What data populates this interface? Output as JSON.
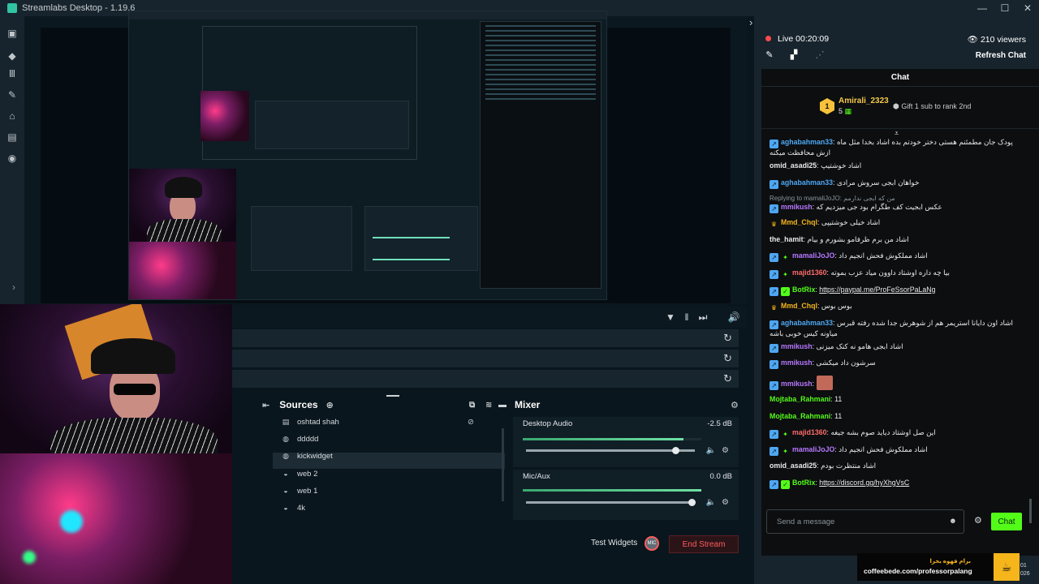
{
  "window": {
    "title": "Streamlabs Desktop - 1.19.6",
    "controls": [
      "—",
      "☐",
      "✕"
    ]
  },
  "scenes": {
    "toolbar_icons": [
      "filter-icon",
      "pause-icon",
      "skip-icon",
      "volume-icon"
    ]
  },
  "sources": {
    "title": "Sources",
    "items": [
      {
        "label": "oshtad shah",
        "icon": "file-icon"
      },
      {
        "label": "ddddd",
        "icon": "globe-icon"
      },
      {
        "label": "kickwidget",
        "icon": "globe-icon"
      },
      {
        "label": "web 2",
        "icon": "webcam-icon"
      },
      {
        "label": "web 1",
        "icon": "webcam-icon"
      },
      {
        "label": "4k",
        "icon": "webcam-icon"
      }
    ]
  },
  "mixer": {
    "title": "Mixer",
    "tracks": [
      {
        "name": "Desktop Audio",
        "db": "-2.5 dB",
        "level": 0.9
      },
      {
        "name": "Mic/Aux",
        "db": "0.0 dB",
        "level": 1.0
      }
    ]
  },
  "footer": {
    "test_widgets": "Test Widgets",
    "mic_label": "MIC",
    "end_stream": "End Stream"
  },
  "live": {
    "status": "Live 00:20:09",
    "viewers": "210 viewers",
    "refresh": "Refresh Chat",
    "color": "#ff4a4a"
  },
  "chat": {
    "title": "Chat",
    "pinned": {
      "rank": "1",
      "user": "Amirali_2323",
      "count": "5",
      "gift": "Gift 1 sub to rank 2nd"
    },
    "messages": [
      {
        "user": "aghabahman33",
        "color": "#4ea7f2",
        "badge": "kick",
        "text": "پودک جان مطمئنم هستی دختر خودتم بده اشاد بخدا مثل ماه ازش محافظت میکنه"
      },
      {
        "user": "omid_asadi25",
        "color": "#e8ebed",
        "badge": "",
        "text": "اشاد خوشتیپ"
      },
      {
        "user": "aghabahman33",
        "color": "#4ea7f2",
        "badge": "kick",
        "text": "خواهان ابجی سروش مرادی"
      },
      {
        "reply": "Replying to mamaliJoJO: من که ابجی ندارمم",
        "user": "mmikush",
        "color": "#b878ff",
        "badge": "kick",
        "text": "عکس ابجیت کف طگرام بود جی میزدیم که"
      },
      {
        "user": "Mmd_Chql",
        "color": "#f5b51b",
        "badge": "crown",
        "text": "اشاد خیلی خوشتیپی"
      },
      {
        "user": "the_hamit",
        "color": "#e8ebed",
        "badge": "",
        "text": "اشاد من برم ظرفامو بشورم و بیام"
      },
      {
        "user": "mamaliJoJO",
        "color": "#b878ff",
        "badge": "kick-star",
        "text": "اشاد مملکوش فحش انجیم داد"
      },
      {
        "user": "majid1360",
        "color": "#ff6b6b",
        "badge": "kick-star",
        "text": "بیا چه داره اوشتاد داوون میاد عزب بموته"
      },
      {
        "user": "BotRix",
        "color": "#53fc18",
        "badge": "kick-verified",
        "text": "https://paypal.me/ProFeSsorPaLaNg",
        "link": true
      },
      {
        "user": "Mmd_Chql",
        "color": "#f5b51b",
        "badge": "crown",
        "text": "بوس بوس"
      },
      {
        "user": "aghabahman33",
        "color": "#4ea7f2",
        "badge": "kick",
        "text": "اشاد اون دایانا استریمر هم از شوهرش جدا شده رفته قبرس میاونه کیس خوبی باشه"
      },
      {
        "user": "mmikush",
        "color": "#b878ff",
        "badge": "kick",
        "text": "اشاد ابجی هامو نه کنک میزنی"
      },
      {
        "user": "mmikush",
        "color": "#b878ff",
        "badge": "kick",
        "text": "سرشون داد میکشی"
      },
      {
        "user": "mmikush",
        "color": "#b878ff",
        "badge": "kick",
        "text": "",
        "emote": true
      },
      {
        "user": "Mojtaba_Rahmani",
        "color": "#53fc18",
        "badge": "",
        "text": "11"
      },
      {
        "user": "Mojtaba_Rahmani",
        "color": "#53fc18",
        "badge": "",
        "text": "11"
      },
      {
        "user": "majid1360",
        "color": "#ff6b6b",
        "badge": "kick-star",
        "text": "این صل اوشتاد دیاید صوم بشه جیغه"
      },
      {
        "user": "mamaliJoJO",
        "color": "#b878ff",
        "badge": "kick-star",
        "text": "اشاد مملکوش فحش انجیم داد"
      },
      {
        "user": "omid_asadi25",
        "color": "#e8ebed",
        "badge": "",
        "text": "اشاد منتظرت بودم"
      },
      {
        "user": "BotRix",
        "color": "#53fc18",
        "badge": "kick-verified",
        "text": "https://discord.gg/hyXhgVsC",
        "link": true
      }
    ],
    "input_placeholder": "Send a message",
    "send_label": "Chat"
  },
  "promo": {
    "persian": "برام قهوه بخرا",
    "url": "coffeebede.com/professorpalang"
  },
  "clock": {
    "line1": "01",
    "line2": "026"
  }
}
